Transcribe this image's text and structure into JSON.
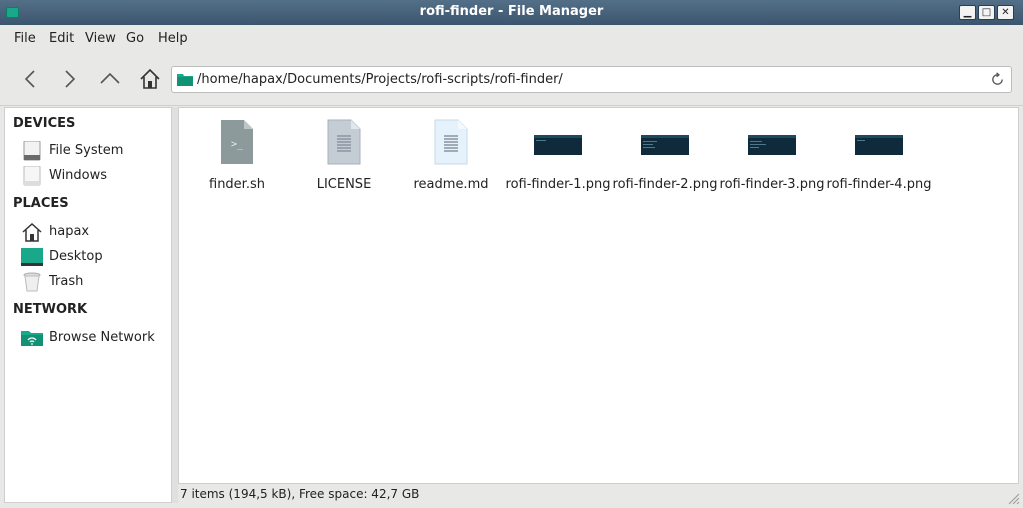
{
  "window": {
    "title": "rofi-finder - File Manager"
  },
  "window_controls": {
    "minimize": "▁",
    "maximize": "□",
    "close": "✕"
  },
  "menu": [
    "File",
    "Edit",
    "View",
    "Go",
    "Help"
  ],
  "location": {
    "path": "/home/hapax/Documents/Projects/rofi-scripts/rofi-finder/"
  },
  "sidebar": {
    "devices_heading": "DEVICES",
    "devices": [
      {
        "label": "File System",
        "icon": "drive-icon"
      },
      {
        "label": "Windows",
        "icon": "drive-icon"
      }
    ],
    "places_heading": "PLACES",
    "places": [
      {
        "label": "hapax",
        "icon": "home-icon"
      },
      {
        "label": "Desktop",
        "icon": "desktop-icon"
      },
      {
        "label": "Trash",
        "icon": "trash-icon"
      }
    ],
    "network_heading": "NETWORK",
    "network": [
      {
        "label": "Browse Network",
        "icon": "network-folder-icon"
      }
    ]
  },
  "files": [
    {
      "name": "finder.sh",
      "icon": "script-icon"
    },
    {
      "name": "LICENSE",
      "icon": "text-file-icon"
    },
    {
      "name": "readme.md",
      "icon": "markdown-file-icon"
    },
    {
      "name": "rofi-finder-1.png",
      "icon": "image-thumbnail"
    },
    {
      "name": "rofi-finder-2.png",
      "icon": "image-thumbnail"
    },
    {
      "name": "rofi-finder-3.png",
      "icon": "image-thumbnail"
    },
    {
      "name": "rofi-finder-4.png",
      "icon": "image-thumbnail"
    }
  ],
  "status": {
    "text": "7 items (194,5 kB), Free space: 42,7 GB"
  },
  "colors": {
    "titlebar": "#3b556d",
    "accent": "#1aa88a",
    "thumbnail": "#0f2a3a"
  }
}
